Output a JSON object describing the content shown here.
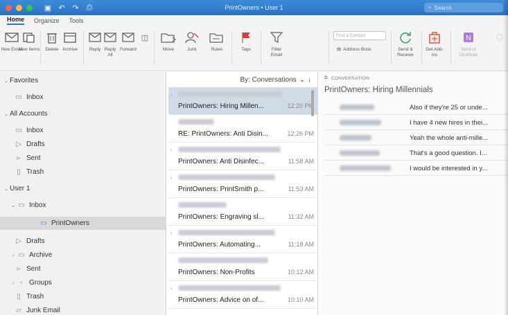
{
  "window": {
    "title": "PrintOwners • User 1",
    "search_placeholder": "Search",
    "colors": {
      "titlebar": "#2a72c4",
      "accent": "#2a72c4",
      "flag": "#d93a3a"
    }
  },
  "quick_access": [
    "save-icon",
    "undo-icon",
    "redo-icon",
    "print-icon"
  ],
  "tabs": [
    {
      "label": "Home",
      "active": true
    },
    {
      "label": "Organize"
    },
    {
      "label": "Tools"
    }
  ],
  "ribbon": {
    "new_email": "New Email",
    "new_items": "New Items",
    "delete": "Delete",
    "archive": "Archive",
    "reply": "Reply",
    "reply_all": "Reply All",
    "forward": "Forward",
    "move": "Move",
    "junk": "Junk",
    "rules": "Rules",
    "tags": "Tags",
    "filter_email": "Filter Email",
    "find_contact": "Find a Contact",
    "address_book": "Address Book",
    "send_receive": "Send & Receive",
    "get_addins": "Get Add-ins",
    "send_to_onenote": "Send to OneNote"
  },
  "folders": {
    "favorites_label": "Favorites",
    "favorites": [
      {
        "label": "Inbox"
      }
    ],
    "all_accounts_label": "All Accounts",
    "all_accounts": [
      {
        "label": "Inbox"
      },
      {
        "label": "Drafts"
      },
      {
        "label": "Sent"
      },
      {
        "label": "Trash"
      }
    ],
    "user_label": "User 1",
    "user_inbox": "Inbox",
    "selected_subfolder": "PrintOwners",
    "user_folders": [
      {
        "label": "Drafts"
      },
      {
        "label": "Archive"
      },
      {
        "label": "Sent"
      },
      {
        "label": "Groups"
      },
      {
        "label": "Trash"
      },
      {
        "label": "Junk Email"
      }
    ]
  },
  "message_list": {
    "sort_label": "By: Conversations",
    "messages": [
      {
        "subject": "PrintOwners: Hiring Millen...",
        "time": "12:20 PM",
        "selected": true
      },
      {
        "subject": "RE: PrintOwners: Anti Disin...",
        "time": "12:26 PM"
      },
      {
        "subject": "PrintOwners:  Anti Disinfec...",
        "time": "11:58 AM"
      },
      {
        "subject": "PrintOwners:  PrintSmith p...",
        "time": "11:53 AM"
      },
      {
        "subject": "PrintOwners:  Engraving sl...",
        "time": "11:32 AM"
      },
      {
        "subject": "PrintOwners:  Automating...",
        "time": "11:18 AM"
      },
      {
        "subject": "PrintOwners:  Non-Profits",
        "time": "10:12 AM"
      },
      {
        "subject": "PrintOwners:  Advice on of...",
        "time": "10:10 AM"
      }
    ]
  },
  "reading_pane": {
    "section_label": "CONVERSATION",
    "title": "PrintOwners: Hiring Millennials",
    "rows": [
      {
        "preview": "Also if they're 25 or unde..."
      },
      {
        "preview": "I have 4 new hires in thei..."
      },
      {
        "preview": "Yeah the whole anti-mille..."
      },
      {
        "preview": "That's a good question. I..."
      },
      {
        "preview": "I would be interested in y..."
      }
    ]
  }
}
